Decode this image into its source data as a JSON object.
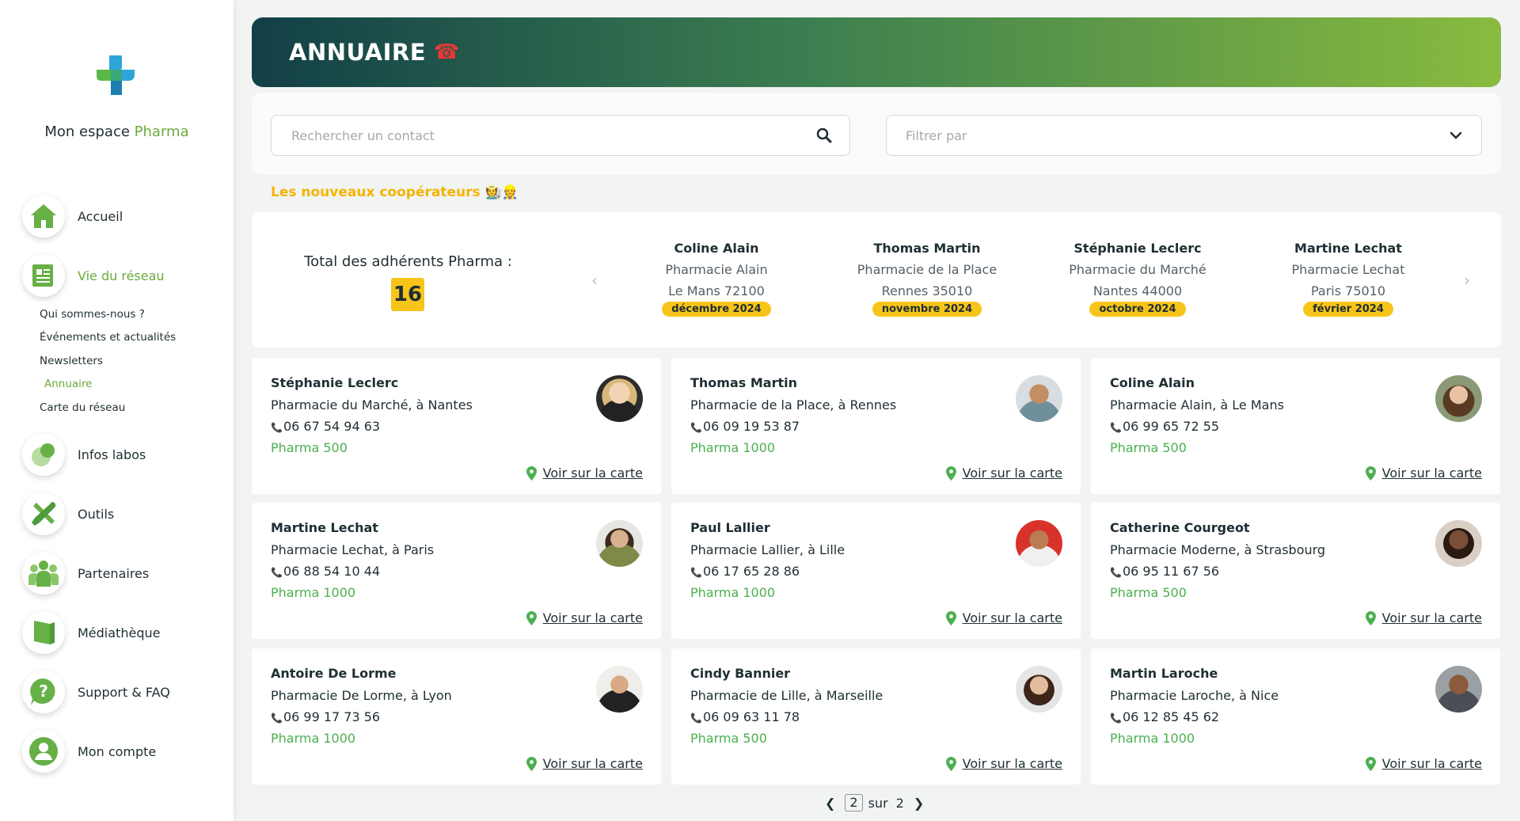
{
  "sidebar": {
    "brand_prefix": "Mon espace ",
    "brand_accent": "Pharma",
    "items": [
      {
        "label": "Accueil",
        "icon": "home-icon"
      },
      {
        "label": "Vie du réseau",
        "icon": "newspaper-icon"
      },
      {
        "label": "Infos labos",
        "icon": "flask-icon"
      },
      {
        "label": "Outils",
        "icon": "tools-icon"
      },
      {
        "label": "Partenaires",
        "icon": "partners-icon"
      },
      {
        "label": "Médiathèque",
        "icon": "book-icon"
      },
      {
        "label": "Support & FAQ",
        "icon": "question-icon"
      },
      {
        "label": "Mon compte",
        "icon": "user-icon"
      }
    ],
    "subitems": [
      "Qui sommes-nous ?",
      "Événements et actualités",
      "Newsletters",
      "Annuaire",
      "Carte du réseau"
    ]
  },
  "header": {
    "title": "ANNUAIRE",
    "icon": "telephone-icon"
  },
  "search": {
    "placeholder": "Rechercher un contact",
    "filter_placeholder": "Filtrer par"
  },
  "new_members": {
    "title": "Les nouveaux coopérateurs 🧑‍🌾👷",
    "total_label": "Total des adhérents Pharma :",
    "total_value": "16",
    "items": [
      {
        "name": "Coline Alain",
        "pharmacy": "Pharmacie Alain",
        "city": "Le Mans 72100",
        "date": "décembre 2024"
      },
      {
        "name": "Thomas Martin",
        "pharmacy": "Pharmacie de la Place",
        "city": "Rennes 35010",
        "date": "novembre 2024"
      },
      {
        "name": "Stéphanie Leclerc",
        "pharmacy": "Pharmacie du Marché",
        "city": "Nantes 44000",
        "date": "octobre 2024"
      },
      {
        "name": "Martine Lechat",
        "pharmacy": "Pharmacie Lechat",
        "city": "Paris 75010",
        "date": "février 2024"
      }
    ]
  },
  "contacts": [
    {
      "name": "Stéphanie Leclerc",
      "pharmacy": "Pharmacie du Marché, à Nantes",
      "phone": "06 67 54 94 63",
      "plan": "Pharma 500",
      "map_label": "Voir sur la carte"
    },
    {
      "name": "Thomas Martin",
      "pharmacy": "Pharmacie de la Place, à Rennes",
      "phone": "06 09 19 53 87",
      "plan": "Pharma 1000",
      "map_label": "Voir sur la carte"
    },
    {
      "name": "Coline Alain",
      "pharmacy": "Pharmacie Alain, à Le Mans",
      "phone": "06 99 65 72 55",
      "plan": "Pharma 500",
      "map_label": "Voir sur la carte"
    },
    {
      "name": "Martine Lechat",
      "pharmacy": "Pharmacie Lechat, à Paris",
      "phone": "06 88 54 10 44",
      "plan": "Pharma 1000",
      "map_label": "Voir sur la carte"
    },
    {
      "name": "Paul Lallier",
      "pharmacy": "Pharmacie Lallier, à Lille",
      "phone": "06 17 65 28 86",
      "plan": "Pharma 1000",
      "map_label": "Voir sur la carte"
    },
    {
      "name": "Catherine Courgeot",
      "pharmacy": "Pharmacie Moderne, à Strasbourg",
      "phone": "06 95 11 67 56",
      "plan": "Pharma 500",
      "map_label": "Voir sur la carte"
    },
    {
      "name": "Antoire De Lorme",
      "pharmacy": "Pharmacie De Lorme, à Lyon",
      "phone": "06 99 17 73 56",
      "plan": "Pharma 1000",
      "map_label": "Voir sur la carte"
    },
    {
      "name": "Cindy Bannier",
      "pharmacy": "Pharmacie de Lille, à Marseille",
      "phone": "06 09 63 11 78",
      "plan": "Pharma 500",
      "map_label": "Voir sur la carte"
    },
    {
      "name": "Martin Laroche",
      "pharmacy": "Pharmacie Laroche, à Nice",
      "phone": "06 12 85 45 62",
      "plan": "Pharma 1000",
      "map_label": "Voir sur la carte"
    }
  ],
  "pagination": {
    "current": "2",
    "separator": "sur",
    "total": "2"
  },
  "colors": {
    "accent_green": "#6aab3c",
    "accent_yellow": "#f7c41a",
    "header_dark": "#123f47",
    "header_light": "#89bb3e"
  }
}
